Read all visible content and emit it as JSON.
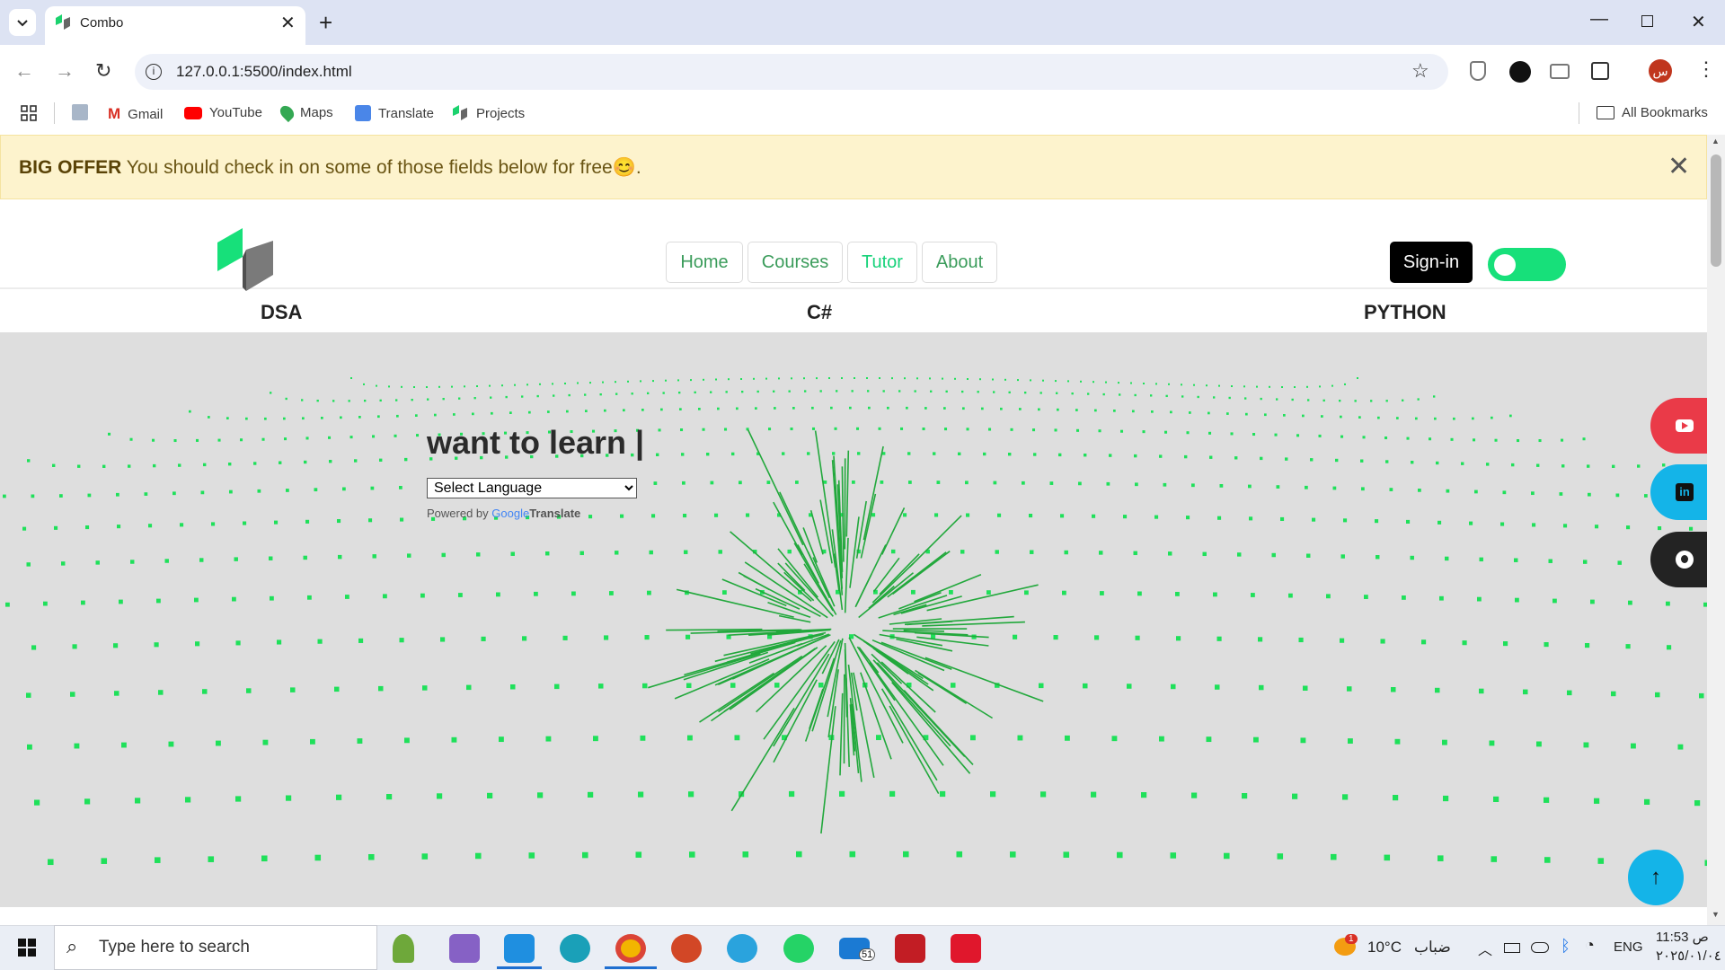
{
  "browser": {
    "tab_title": "Combo",
    "url": "127.0.0.1:5500/index.html",
    "bookmarks": [
      "Gmail",
      "YouTube",
      "Maps",
      "Translate",
      "Projects"
    ],
    "all_bookmarks": "All Bookmarks"
  },
  "alert": {
    "bold": "BIG OFFER",
    "text": " You should check in on some of those fields below for free😊."
  },
  "nav": {
    "items": [
      "Home",
      "Courses",
      "Tutor",
      "About"
    ],
    "signin": "Sign-in"
  },
  "subnav": [
    "DSA",
    "C#",
    "PYTHON"
  ],
  "hero": {
    "title": "want to learn |",
    "select_placeholder": "Select Language",
    "powered_by": "Powered by",
    "google": "Google",
    "translate": "Translate"
  },
  "colors": {
    "accent_green": "#17e07a",
    "nav_text": "#3b9c5b",
    "youtube": "#ea3a48",
    "linkedin": "#14b4e8",
    "github": "#232323"
  },
  "taskbar": {
    "search_placeholder": "Type here to search",
    "weather": "10°C",
    "weather_desc": "ضباب",
    "lang": "ENG",
    "time": "11:53 ص",
    "date": "٢٠٢٥/٠١/٠٤",
    "weather_badge": "1",
    "mail_badge": "51"
  }
}
